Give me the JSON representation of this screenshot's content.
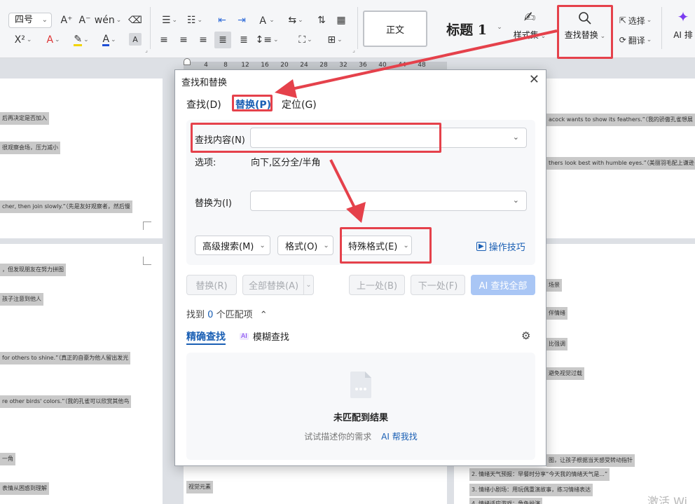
{
  "ribbon": {
    "font_size": "四号",
    "font_tools": [
      "A⁺",
      "A⁻",
      "wén"
    ],
    "eraser": "⌫",
    "superscript": "X²",
    "style_normal": "正文",
    "style_heading": "标题 1",
    "style_set_label": "样式集",
    "find_replace_label": "查找替换",
    "select_label": "选择",
    "translate_label": "翻译",
    "ai_label": "AI 排"
  },
  "ruler": {
    "ticks": [
      "4",
      "8",
      "12",
      "16",
      "20",
      "24",
      "28",
      "32",
      "36",
      "40",
      "44",
      "48"
    ]
  },
  "document": {
    "left_lines": [
      "后再决定是否加入",
      "很观察会场，压力减小",
      "cher, then join slowly.”（先是友好观察者，然后慢",
      "，但发现朋友在努力拼图",
      "孩子注意到他人",
      "for others to shine.”（真正的自豪为他人留出发光",
      "re other birds' colors.”（我的孔雀可以欣赏其他鸟",
      "一角",
      "表情从困惑到理解"
    ],
    "right_lines": [
      "acock wants to show its feathers.”（我的骄傲孔雀想展",
      "thers look best with humble eyes.”（美丽羽毛配上谦逊",
      "场景",
      "伴情绪",
      "比强调",
      "避免视觉过载",
      "图，让孩子根据当天感受转动指针",
      "2. 情绪天气预报：早餐时分享“今天我的情绪天气是...”",
      "3. 情绪小剧场：用玩偶重演故事，练习情绪表达",
      "4. 情绪适应游戏：角色扮演"
    ],
    "mid_line": "视觉元素",
    "watermark": "激活 Wi"
  },
  "dialog": {
    "title": "查找和替换",
    "tabs": [
      "查找(D)",
      "替换(P)",
      "定位(G)"
    ],
    "find_label": "查找内容(N)",
    "find_value": "",
    "options_label": "选项:",
    "options_value": "向下,区分全/半角",
    "replace_label": "替换为(I)",
    "replace_value": "",
    "advanced_search": "高级搜索(M)",
    "format": "格式(O)",
    "special_format": "特殊格式(E)",
    "tips": "操作技巧",
    "btn_replace": "替换(R)",
    "btn_replace_all": "全部替换(A)",
    "btn_prev": "上一处(B)",
    "btn_next": "下一处(F)",
    "btn_ai_find_all": "AI 查找全部",
    "found_prefix": "找到",
    "found_count": "0",
    "found_suffix": "个匹配项",
    "mode_exact": "精确查找",
    "mode_fuzzy": "模糊查找",
    "ai_badge": "AI",
    "empty_title": "未匹配到结果",
    "empty_hint": "试试描述你的需求",
    "ai_help": "AI 帮我找"
  },
  "colors": {
    "accent_blue": "#1a5fb4",
    "annotation_red": "#e5414b",
    "disabled_blue": "#a9c6f5"
  }
}
